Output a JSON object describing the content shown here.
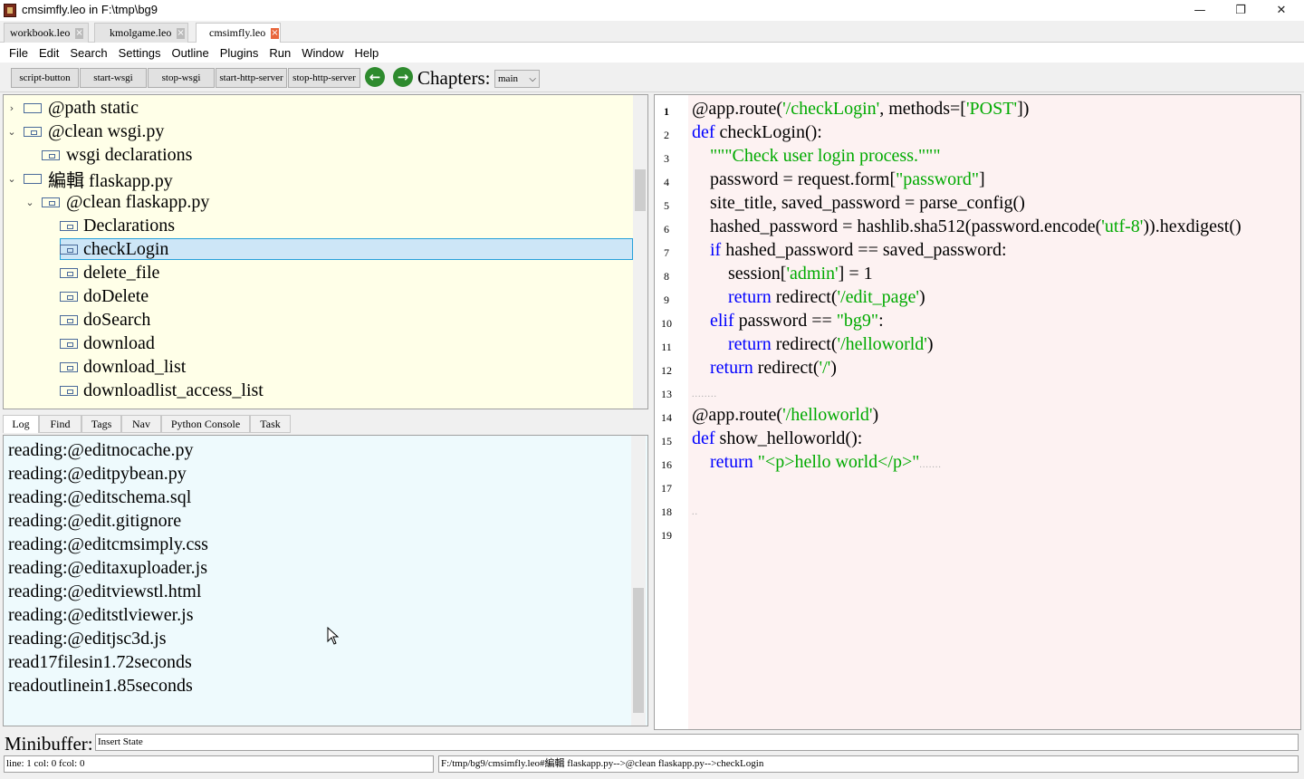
{
  "window": {
    "title": "cmsimfly.leo in F:\\tmp\\bg9",
    "minimize": "—",
    "restore": "❐",
    "close": "✕"
  },
  "file_tabs": [
    {
      "label": "workbook.leo",
      "close": "×"
    },
    {
      "label": "kmolgame.leo",
      "close": "×"
    },
    {
      "label": "cmsimfly.leo",
      "close": "×"
    }
  ],
  "menu": [
    "File",
    "Edit",
    "Search",
    "Settings",
    "Outline",
    "Plugins",
    "Run",
    "Window",
    "Help"
  ],
  "toolbar": {
    "buttons": [
      "script-button",
      "start-wsgi",
      "stop-wsgi",
      "start-http-server",
      "stop-http-server"
    ],
    "back_glyph": "←",
    "forward_glyph": "→",
    "chapters_label": "Chapters:",
    "chapters_value": "main",
    "chapters_arrow": "⌵"
  },
  "outline": {
    "nodes": [
      {
        "chevron": "›",
        "text": "@path static"
      },
      {
        "chevron": "⌄",
        "text": "@clean wsgi.py"
      },
      {
        "chevron": "",
        "text": "wsgi declarations"
      },
      {
        "chevron": "⌄",
        "text": "編輯 flaskapp.py"
      },
      {
        "chevron": "⌄",
        "text": "@clean flaskapp.py"
      },
      {
        "chevron": "",
        "text": "Declarations"
      },
      {
        "chevron": "",
        "text": "checkLogin"
      },
      {
        "chevron": "",
        "text": "delete_file"
      },
      {
        "chevron": "",
        "text": "doDelete"
      },
      {
        "chevron": "",
        "text": "doSearch"
      },
      {
        "chevron": "",
        "text": "download"
      },
      {
        "chevron": "",
        "text": "download_list"
      },
      {
        "chevron": "",
        "text": "downloadlist_access_list"
      }
    ],
    "selected": "checkLogin"
  },
  "log_tabs": [
    "Log",
    "Find",
    "Tags",
    "Nav",
    "Python Console",
    "Task"
  ],
  "log_lines": [
    "reading:@editnocache.py",
    "reading:@editpybean.py",
    "reading:@editschema.sql",
    "reading:@edit.gitignore",
    "reading:@editcmsimply.css",
    "reading:@editaxuploader.js",
    "reading:@editviewstl.html",
    "reading:@editstlviewer.js",
    "reading:@editjsc3d.js",
    "read17filesin1.72seconds",
    "readoutlinein1.85seconds"
  ],
  "body": {
    "line_numbers": [
      "1",
      "2",
      "3",
      "4",
      "5",
      "6",
      "7",
      "8",
      "9",
      "10",
      "11",
      "12",
      "13",
      "14",
      "15",
      "16",
      "17",
      "18",
      "19"
    ],
    "lines": [
      [
        {
          "t": "@app.route("
        },
        {
          "t": "'/checkLogin'",
          "c": "str"
        },
        {
          "t": ", methods=["
        },
        {
          "t": "'POST'",
          "c": "str"
        },
        {
          "t": "])"
        }
      ],
      [
        {
          "t": "def",
          "c": "kw"
        },
        {
          "t": " checkLogin():"
        }
      ],
      [
        {
          "t": "    "
        },
        {
          "t": "\"\"\"Check user login process.\"\"\"",
          "c": "doc"
        }
      ],
      [
        {
          "t": "    password = request.form["
        },
        {
          "t": "\"password\"",
          "c": "str"
        },
        {
          "t": "]"
        }
      ],
      [
        {
          "t": "    site_title, saved_password = parse_config()"
        }
      ],
      [
        {
          "t": "    hashed_password = hashlib.sha512(password.encode("
        },
        {
          "t": "'utf-8'",
          "c": "str"
        },
        {
          "t": ")).hexdigest()"
        }
      ],
      [
        {
          "t": "    "
        },
        {
          "t": "if",
          "c": "kw"
        },
        {
          "t": " hashed_password == saved_password:"
        }
      ],
      [
        {
          "t": "        session["
        },
        {
          "t": "'admin'",
          "c": "str"
        },
        {
          "t": "] = 1"
        }
      ],
      [
        {
          "t": "        "
        },
        {
          "t": "return",
          "c": "kw"
        },
        {
          "t": " redirect("
        },
        {
          "t": "'/edit_page'",
          "c": "str"
        },
        {
          "t": ")"
        }
      ],
      [
        {
          "t": "    "
        },
        {
          "t": "elif",
          "c": "kw"
        },
        {
          "t": " password == "
        },
        {
          "t": "\"bg9\"",
          "c": "str"
        },
        {
          "t": ":"
        }
      ],
      [
        {
          "t": "        "
        },
        {
          "t": "return",
          "c": "kw"
        },
        {
          "t": " redirect("
        },
        {
          "t": "'/helloworld'",
          "c": "str"
        },
        {
          "t": ")"
        }
      ],
      [
        {
          "t": "    "
        },
        {
          "t": "return",
          "c": "kw"
        },
        {
          "t": " redirect("
        },
        {
          "t": "'/'",
          "c": "str"
        },
        {
          "t": ")"
        }
      ],
      [
        {
          "t": "........",
          "c": "dots"
        }
      ],
      [
        {
          "t": "@app.route("
        },
        {
          "t": "'/helloworld'",
          "c": "str"
        },
        {
          "t": ")"
        }
      ],
      [
        {
          "t": "def",
          "c": "kw"
        },
        {
          "t": " show_helloworld():"
        }
      ],
      [
        {
          "t": "    "
        },
        {
          "t": "return",
          "c": "kw"
        },
        {
          "t": " "
        },
        {
          "t": "\"<p>hello world</p>\"",
          "c": "str"
        },
        {
          "t": ".......",
          "c": "dots"
        }
      ],
      [],
      [
        {
          "t": "..",
          "c": "dots"
        }
      ],
      []
    ]
  },
  "minibuffer": {
    "label": "Minibuffer:",
    "value": "Insert State"
  },
  "status": {
    "position": "line: 1 col: 0 fcol: 0",
    "path": "F:/tmp/bg9/cmsimfly.leo#編輯 flaskapp.py-->@clean flaskapp.py-->checkLogin"
  },
  "colors": {
    "outline_bg": "#ffffe8",
    "log_bg": "#eefafd",
    "body_bg": "#fdf2f2",
    "selection": "#cde6f7",
    "keyword": "#0000ff",
    "string": "#00aa00"
  }
}
